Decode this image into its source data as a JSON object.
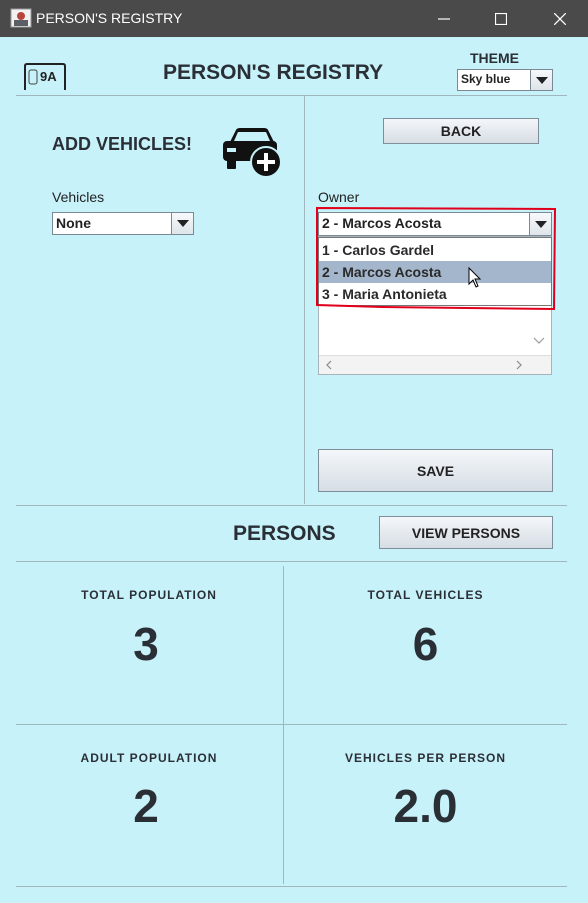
{
  "window": {
    "title": "PERSON'S REGISTRY"
  },
  "header": {
    "logo_text": "9A",
    "title": "PERSON'S REGISTRY",
    "theme_label": "THEME",
    "theme_value": "Sky blue"
  },
  "add_vehicles": {
    "title": "ADD VEHICLES!",
    "icon": "car-add-icon",
    "vehicles_label": "Vehicles",
    "vehicles_value": "None"
  },
  "owner": {
    "back_label": "BACK",
    "owner_label": "Owner",
    "selected": "2 - Marcos Acosta",
    "options": [
      "1 - Carlos Gardel",
      "2 - Marcos Acosta",
      "3 - Maria Antonieta"
    ],
    "save_label": "SAVE"
  },
  "persons": {
    "title": "PERSONS",
    "view_label": "VIEW PERSONS"
  },
  "stats": {
    "total_population_label": "TOTAL POPULATION",
    "total_population": "3",
    "total_vehicles_label": "TOTAL VEHICLES",
    "total_vehicles": "6",
    "adult_population_label": "ADULT POPULATION",
    "adult_population": "2",
    "vehicles_per_person_label": "VEHICLES PER PERSON",
    "vehicles_per_person": "2.0"
  },
  "colors": {
    "background": "#c8f2fa",
    "titlebar": "#4a4a4a",
    "highlight": "#a3b6cc",
    "annotation": "#e0001b"
  }
}
